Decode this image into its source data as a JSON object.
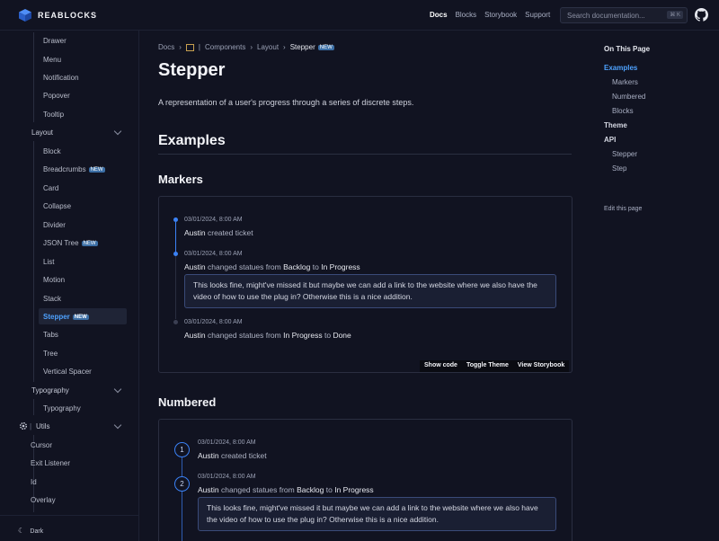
{
  "header": {
    "logo_text": "REABLOCKS",
    "nav": [
      "Docs",
      "Blocks",
      "Storybook",
      "Support"
    ],
    "search_placeholder": "Search documentation...",
    "search_shortcut": "⌘ K"
  },
  "sidebar": {
    "items_top": [
      "Drawer",
      "Menu",
      "Notification",
      "Popover",
      "Tooltip"
    ],
    "group_layout": "Layout",
    "layout_items": [
      "Block",
      "Breadcrumbs",
      "Card",
      "Collapse",
      "Divider",
      "JSON Tree",
      "List",
      "Motion",
      "Stack",
      "Stepper",
      "Tabs",
      "Tree",
      "Vertical Spacer"
    ],
    "group_typography": "Typography",
    "typography_items": [
      "Typography"
    ],
    "group_utils": "Utils",
    "utils_items": [
      "Cursor",
      "Exit Listener",
      "Id",
      "Overlay"
    ],
    "new_badge": "NEW",
    "theme_toggle": "Dark"
  },
  "breadcrumbs": [
    "Docs",
    "Components",
    "Layout",
    "Stepper"
  ],
  "page": {
    "title": "Stepper",
    "lead": "A representation of a user's progress through a series of discrete steps.",
    "examples_heading": "Examples",
    "markers_heading": "Markers",
    "numbered_heading": "Numbered"
  },
  "steps": {
    "timestamp": "03/01/2024, 8:00 AM",
    "author": "Austin",
    "created": "created ticket",
    "changed": "changed statues from",
    "to": "to",
    "backlog": "Backlog",
    "in_progress": "In Progress",
    "done": "Done",
    "comment": "This looks fine, might've missed it but maybe we can add a link to the website where we also have the video of how to use the plug in? Otherwise this is a nice addition.",
    "num1": "1",
    "num2": "2"
  },
  "toolbar": [
    "Show code",
    "Toggle Theme",
    "View Storybook"
  ],
  "toc": {
    "title": "On This Page",
    "examples": "Examples",
    "markers": "Markers",
    "numbered": "Numbered",
    "blocks": "Blocks",
    "theme": "Theme",
    "api": "API",
    "api_stepper": "Stepper",
    "api_step": "Step",
    "edit": "Edit this page"
  },
  "colors": {
    "accent": "#3b82f6",
    "link": "#4ea2ff",
    "background": "#111321"
  }
}
